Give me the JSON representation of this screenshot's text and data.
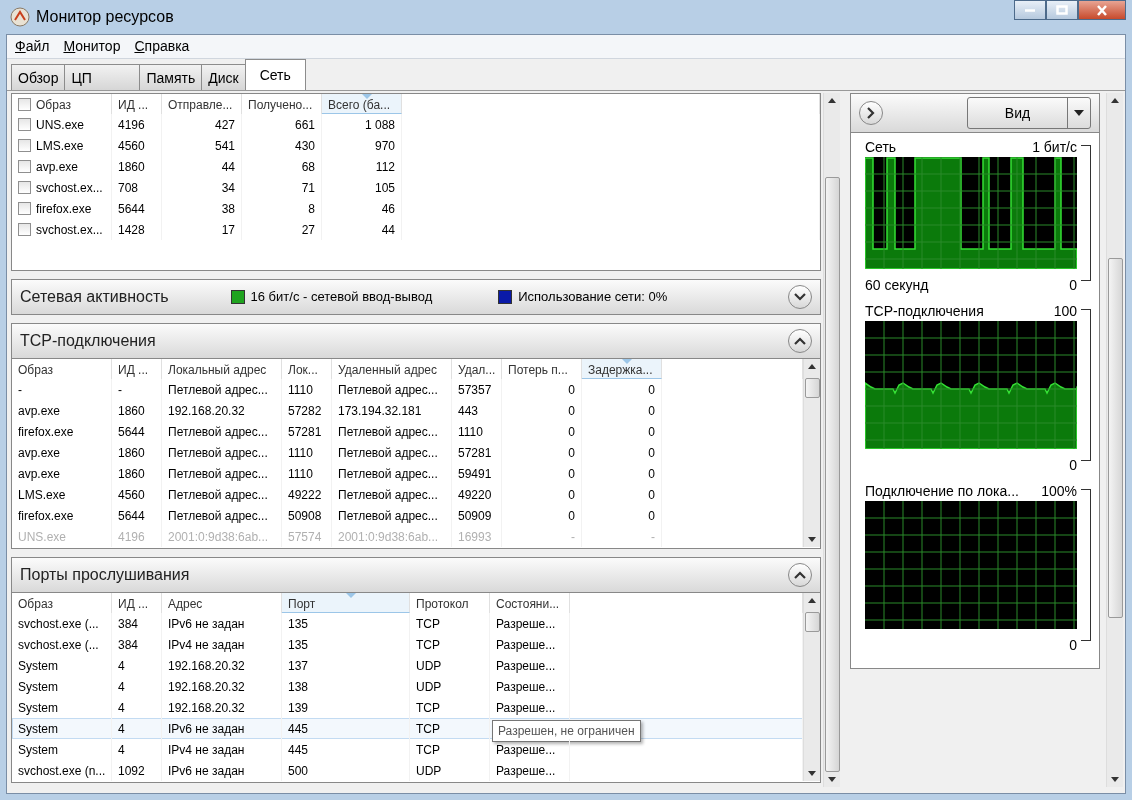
{
  "window": {
    "title": "Монитор ресурсов"
  },
  "menu": [
    {
      "label": "Файл"
    },
    {
      "label": "Монитор"
    },
    {
      "label": "Справка"
    }
  ],
  "tabs": [
    {
      "label": "Обзор",
      "selected": false
    },
    {
      "label": "ЦП",
      "selected": false
    },
    {
      "label": "Память",
      "selected": false
    },
    {
      "label": "Диск",
      "selected": false
    },
    {
      "label": "Сеть",
      "selected": true
    }
  ],
  "processes": {
    "header_checked": false,
    "columns": [
      {
        "label": "Образ",
        "sorted": false
      },
      {
        "label": "ИД ...",
        "sorted": false
      },
      {
        "label": "Отправле...",
        "sorted": false
      },
      {
        "label": "Получено...",
        "sorted": false
      },
      {
        "label": "Всего (ба...",
        "sorted": true
      }
    ],
    "rows": [
      {
        "checked": false,
        "cells": [
          "UNS.exe",
          "4196",
          "427",
          "661",
          "1 088"
        ]
      },
      {
        "checked": false,
        "cells": [
          "LMS.exe",
          "4560",
          "541",
          "430",
          "970"
        ]
      },
      {
        "checked": false,
        "cells": [
          "avp.exe",
          "1860",
          "44",
          "68",
          "112"
        ]
      },
      {
        "checked": false,
        "cells": [
          "svchost.ex...",
          "708",
          "34",
          "71",
          "105"
        ]
      },
      {
        "checked": false,
        "cells": [
          "firefox.exe",
          "5644",
          "38",
          "8",
          "46"
        ]
      },
      {
        "checked": false,
        "cells": [
          "svchost.ex...",
          "1428",
          "17",
          "27",
          "44"
        ]
      }
    ]
  },
  "network_activity": {
    "title": "Сетевая активность",
    "expanded": false,
    "legend": [
      {
        "text": "16 бит/с - сетевой ввод-вывод",
        "color": "#1fa31f"
      },
      {
        "text": "Использование сети: 0%",
        "color": "#0a1aa8"
      }
    ]
  },
  "tcp": {
    "title": "TCP-подключения",
    "expanded": true,
    "columns": [
      {
        "label": "Образ",
        "sorted": false
      },
      {
        "label": "ИД ...",
        "sorted": false
      },
      {
        "label": "Локальный адрес",
        "sorted": false
      },
      {
        "label": "Лок...",
        "sorted": false
      },
      {
        "label": "Удаленный адрес",
        "sorted": false
      },
      {
        "label": "Удал...",
        "sorted": false
      },
      {
        "label": "Потерь п...",
        "sorted": false
      },
      {
        "label": "Задержка...",
        "sorted": true
      }
    ],
    "rows": [
      {
        "ended": false,
        "cells": [
          "-",
          "-",
          "Петлевой адрес...",
          "1110",
          "Петлевой адрес...",
          "57357",
          "0",
          "0"
        ]
      },
      {
        "ended": false,
        "cells": [
          "avp.exe",
          "1860",
          "192.168.20.32",
          "57282",
          "173.194.32.181",
          "443",
          "0",
          "0"
        ]
      },
      {
        "ended": false,
        "cells": [
          "firefox.exe",
          "5644",
          "Петлевой адрес...",
          "57281",
          "Петлевой адрес...",
          "1110",
          "0",
          "0"
        ]
      },
      {
        "ended": false,
        "cells": [
          "avp.exe",
          "1860",
          "Петлевой адрес...",
          "1110",
          "Петлевой адрес...",
          "57281",
          "0",
          "0"
        ]
      },
      {
        "ended": false,
        "cells": [
          "avp.exe",
          "1860",
          "Петлевой адрес...",
          "1110",
          "Петлевой адрес...",
          "59491",
          "0",
          "0"
        ]
      },
      {
        "ended": false,
        "cells": [
          "LMS.exe",
          "4560",
          "Петлевой адрес...",
          "49222",
          "Петлевой адрес...",
          "49220",
          "0",
          "0"
        ]
      },
      {
        "ended": false,
        "cells": [
          "firefox.exe",
          "5644",
          "Петлевой адрес...",
          "50908",
          "Петлевой адрес...",
          "50909",
          "0",
          "0"
        ]
      },
      {
        "ended": true,
        "cells": [
          "UNS.exe",
          "4196",
          "2001:0:9d38:6ab...",
          "57574",
          "2001:0:9d38:6ab...",
          "16993",
          "-",
          "-"
        ]
      }
    ]
  },
  "ports": {
    "title": "Порты прослушивания",
    "expanded": true,
    "columns": [
      {
        "label": "Образ",
        "sorted": false
      },
      {
        "label": "ИД ...",
        "sorted": false
      },
      {
        "label": "Адрес",
        "sorted": false
      },
      {
        "label": "Порт",
        "sorted": true
      },
      {
        "label": "Протокол",
        "sorted": false
      },
      {
        "label": "Состояни...",
        "sorted": false
      }
    ],
    "rows": [
      {
        "selected": false,
        "cells": [
          "svchost.exe (...",
          "384",
          "IPv6 не задан",
          "135",
          "TCP",
          "Разреше..."
        ]
      },
      {
        "selected": false,
        "cells": [
          "svchost.exe (...",
          "384",
          "IPv4 не задан",
          "135",
          "TCP",
          "Разреше..."
        ]
      },
      {
        "selected": false,
        "cells": [
          "System",
          "4",
          "192.168.20.32",
          "137",
          "UDP",
          "Разреше..."
        ]
      },
      {
        "selected": false,
        "cells": [
          "System",
          "4",
          "192.168.20.32",
          "138",
          "UDP",
          "Разреше..."
        ]
      },
      {
        "selected": false,
        "cells": [
          "System",
          "4",
          "192.168.20.32",
          "139",
          "TCP",
          "Разреше..."
        ]
      },
      {
        "selected": true,
        "cells": [
          "System",
          "4",
          "IPv6 не задан",
          "445",
          "TCP"
        ],
        "tooltip": "Разрешен, не ограничен"
      },
      {
        "selected": false,
        "cells": [
          "System",
          "4",
          "IPv4 не задан",
          "445",
          "TCP",
          "Разреше..."
        ]
      },
      {
        "selected": false,
        "cells": [
          "svchost.exe (n...",
          "1092",
          "IPv6 не задан",
          "500",
          "UDP",
          "Разреше..."
        ]
      }
    ]
  },
  "side": {
    "view_button": "Вид",
    "graphs": [
      {
        "kind": "pulses",
        "title": "Сеть",
        "max": "1 бит/с",
        "time": "60 секунд",
        "min": "0"
      },
      {
        "kind": "steady",
        "title": "TCP-подключения",
        "max": "100",
        "min": "0"
      },
      {
        "kind": "empty",
        "title": "Подключение по лока...",
        "max": "100%",
        "min": "0"
      }
    ]
  }
}
